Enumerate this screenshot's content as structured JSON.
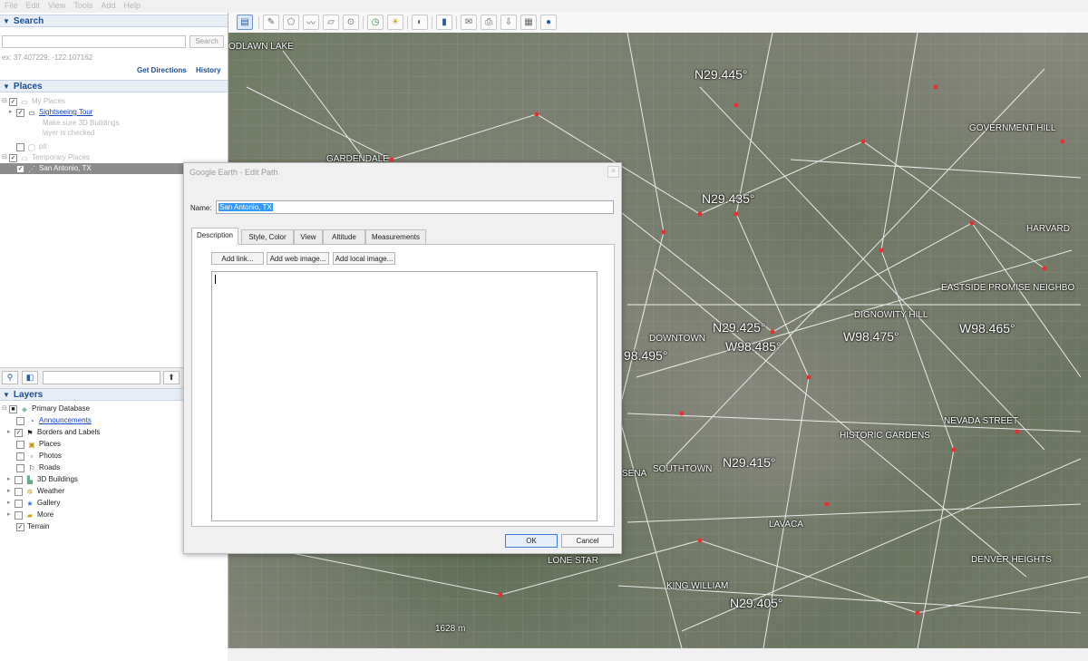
{
  "menu": [
    "File",
    "Edit",
    "View",
    "Tools",
    "Add",
    "Help"
  ],
  "search": {
    "header": "Search",
    "placeholder": "",
    "button": "Search",
    "hint": "ex: 37.407229, -122.107162",
    "get_directions": "Get Directions",
    "history": "History"
  },
  "places": {
    "header": "Places",
    "items": [
      {
        "label": "My Places",
        "checked": true
      },
      {
        "label": "Sightseeing Tour",
        "note1": "Make sure 3D Buildings",
        "note2": "layer is checked"
      },
      {
        "label": "pit"
      },
      {
        "label": "Temporary Places"
      },
      {
        "label": "San Antonio, TX"
      }
    ]
  },
  "layers": {
    "header": "Layers",
    "items": [
      {
        "label": "Primary Database"
      },
      {
        "label": "Announcements"
      },
      {
        "label": "Borders and Labels"
      },
      {
        "label": "Places"
      },
      {
        "label": "Photos"
      },
      {
        "label": "Roads"
      },
      {
        "label": "3D Buildings"
      },
      {
        "label": "Weather"
      },
      {
        "label": "Gallery"
      },
      {
        "label": "More"
      },
      {
        "label": "Terrain"
      }
    ]
  },
  "dialog": {
    "title": "Google Earth - Edit Path",
    "name_label": "Name:",
    "name_value": "San Antonio, TX",
    "tabs": [
      "Description",
      "Style, Color",
      "View",
      "Altitude",
      "Measurements"
    ],
    "add_link": "Add link...",
    "add_web_image": "Add web image...",
    "add_local_image": "Add local image...",
    "ok": "OK",
    "cancel": "Cancel"
  },
  "map_labels": {
    "oaklawn": "ODLAWN LAKE",
    "n29445": "N29.445°",
    "gardendale": "GARDENDALE",
    "government_hill": "GOVERNMENT HILL",
    "n29435": "N29.435°",
    "harvard": "HARVARD",
    "eastside": "EASTSIDE PROMISE NEIGHBO",
    "dignowity": "DIGNOWITY HILL",
    "w98465": "W98.465°",
    "n29425": "N29.425°",
    "downtown": "DOWNTOWN",
    "w98485": "W98.485°",
    "w98475": "W98.475°",
    "w98495": "98.495°",
    "nevada": "NEVADA STREET",
    "historic": "HISTORIC GARDENS",
    "n29415": "N29.415°",
    "southtown": "SOUTHTOWN",
    "sena": "SENA",
    "lavaca": "LAVACA",
    "lonestar": "LONE STAR",
    "denver": "DENVER HEIGHTS",
    "kingwilliam": "KING WILLIAM",
    "n29405": "N29.405°",
    "scale": "1628 m"
  }
}
